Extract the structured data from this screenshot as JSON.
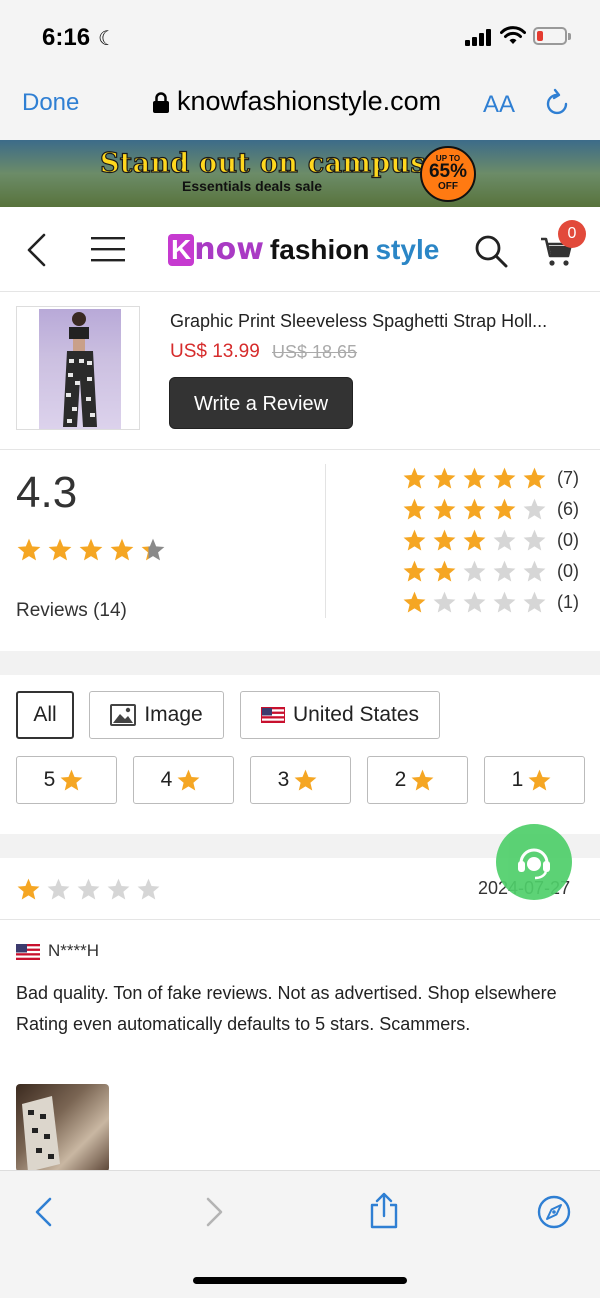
{
  "status_bar": {
    "time": "6:16",
    "moon": "☾"
  },
  "browser": {
    "done_label": "Done",
    "url": "knowfashionstyle.com",
    "text_size_label": "AA"
  },
  "banner": {
    "headline": "Stand out on campus",
    "subline": "Essentials deals sale",
    "promo_top": "UP TO",
    "promo_value": "65%",
    "promo_bottom": "OFF"
  },
  "site_header": {
    "logo": {
      "k": "K",
      "now": "now",
      "fashion": "fashion",
      "style": "style"
    },
    "cart_count": "0"
  },
  "product": {
    "name": "Graphic Print Sleeveless Spaghetti Strap Holl...",
    "price": "US$ 13.99",
    "old_price": "US$ 18.65",
    "write_review_label": "Write a Review"
  },
  "rating_summary": {
    "score": "4.3",
    "score_value": 4.3,
    "reviews_label": "Reviews (14)",
    "breakdown": [
      {
        "stars": 5,
        "count": "(7)"
      },
      {
        "stars": 4,
        "count": "(6)"
      },
      {
        "stars": 3,
        "count": "(0)"
      },
      {
        "stars": 2,
        "count": "(0)"
      },
      {
        "stars": 1,
        "count": "(1)"
      }
    ]
  },
  "filters": {
    "all_label": "All",
    "image_label": "Image",
    "country_label": "United States",
    "star_filters": [
      "5",
      "4",
      "3",
      "2",
      "1"
    ]
  },
  "review": {
    "stars": 1,
    "date": "2024-07-27",
    "user": "N****H",
    "text": "Bad quality. Ton of fake reviews. Not as advertised. Shop elsewhere Rating even automatically defaults to 5 stars. Scammers."
  },
  "colors": {
    "star_filled": "#f5a623",
    "star_empty": "#d6d6d6",
    "price_red": "#d62c2c",
    "ios_blue": "#2f7fd3",
    "chat_green": "#4fcf6a"
  }
}
